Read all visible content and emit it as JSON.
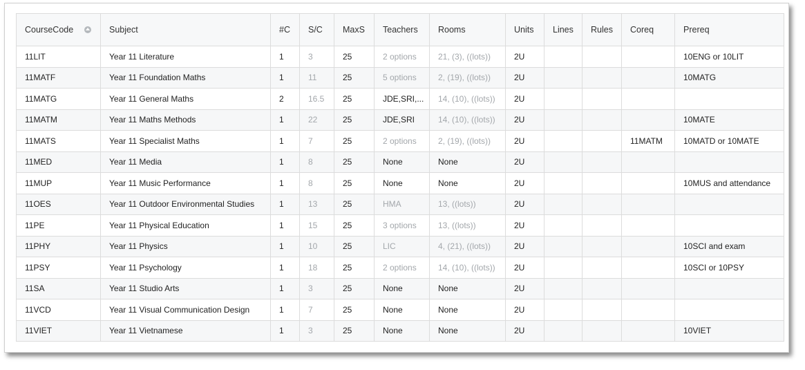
{
  "columns": [
    {
      "key": "code",
      "label": "CourseCode"
    },
    {
      "key": "subject",
      "label": "Subject"
    },
    {
      "key": "c",
      "label": "#C"
    },
    {
      "key": "sc",
      "label": "S/C"
    },
    {
      "key": "maxs",
      "label": "MaxS"
    },
    {
      "key": "teachers",
      "label": "Teachers"
    },
    {
      "key": "rooms",
      "label": "Rooms"
    },
    {
      "key": "units",
      "label": "Units"
    },
    {
      "key": "lines",
      "label": "Lines"
    },
    {
      "key": "rules",
      "label": "Rules"
    },
    {
      "key": "coreq",
      "label": "Coreq"
    },
    {
      "key": "prereq",
      "label": "Prereq"
    }
  ],
  "sort_icon": "sort-ascending-icon",
  "colors": {
    "muted_text": "#a3a7ab",
    "stripe": "#f6f7f8",
    "header_bg": "#f7f8f9",
    "border": "#dcdcdc"
  },
  "rows": [
    {
      "code": "11LIT",
      "subject": "Year 11 Literature",
      "c": "1",
      "sc": "3",
      "maxs": "25",
      "teachers": "2 options",
      "teachers_muted": true,
      "rooms": "21, (3), ((lots))",
      "rooms_muted": true,
      "units": "2U",
      "lines": "",
      "rules": "",
      "coreq": "",
      "prereq": "10ENG or 10LIT"
    },
    {
      "code": "11MATF",
      "subject": "Year 11 Foundation Maths",
      "c": "1",
      "sc": "11",
      "maxs": "25",
      "teachers": "5 options",
      "teachers_muted": true,
      "rooms": "2, (19), ((lots))",
      "rooms_muted": true,
      "units": "2U",
      "lines": "",
      "rules": "",
      "coreq": "",
      "prereq": "10MATG"
    },
    {
      "code": "11MATG",
      "subject": "Year 11 General Maths",
      "c": "2",
      "sc": "16.5",
      "maxs": "25",
      "teachers": "JDE,SRI,...",
      "teachers_muted": false,
      "rooms": "14, (10), ((lots))",
      "rooms_muted": true,
      "units": "2U",
      "lines": "",
      "rules": "",
      "coreq": "",
      "prereq": ""
    },
    {
      "code": "11MATM",
      "subject": "Year 11 Maths Methods",
      "c": "1",
      "sc": "22",
      "maxs": "25",
      "teachers": "JDE,SRI",
      "teachers_muted": false,
      "rooms": "14, (10), ((lots))",
      "rooms_muted": true,
      "units": "2U",
      "lines": "",
      "rules": "",
      "coreq": "",
      "prereq": "10MATE"
    },
    {
      "code": "11MATS",
      "subject": "Year 11 Specialist Maths",
      "c": "1",
      "sc": "7",
      "maxs": "25",
      "teachers": "2 options",
      "teachers_muted": true,
      "rooms": "2, (19), ((lots))",
      "rooms_muted": true,
      "units": "2U",
      "lines": "",
      "rules": "",
      "coreq": "11MATM",
      "prereq": "10MATD or 10MATE"
    },
    {
      "code": "11MED",
      "subject": "Year 11 Media",
      "c": "1",
      "sc": "8",
      "maxs": "25",
      "teachers": "None",
      "teachers_muted": false,
      "rooms": "None",
      "rooms_muted": false,
      "units": "2U",
      "lines": "",
      "rules": "",
      "coreq": "",
      "prereq": ""
    },
    {
      "code": "11MUP",
      "subject": "Year 11 Music Performance",
      "c": "1",
      "sc": "8",
      "maxs": "25",
      "teachers": "None",
      "teachers_muted": false,
      "rooms": "None",
      "rooms_muted": false,
      "units": "2U",
      "lines": "",
      "rules": "",
      "coreq": "",
      "prereq": "10MUS and attendance"
    },
    {
      "code": "11OES",
      "subject": "Year 11 Outdoor Environmental Studies",
      "c": "1",
      "sc": "13",
      "maxs": "25",
      "teachers": "HMA",
      "teachers_muted": true,
      "rooms": "13, ((lots))",
      "rooms_muted": true,
      "units": "2U",
      "lines": "",
      "rules": "",
      "coreq": "",
      "prereq": ""
    },
    {
      "code": "11PE",
      "subject": "Year 11 Physical Education",
      "c": "1",
      "sc": "15",
      "maxs": "25",
      "teachers": "3 options",
      "teachers_muted": true,
      "rooms": "13, ((lots))",
      "rooms_muted": true,
      "units": "2U",
      "lines": "",
      "rules": "",
      "coreq": "",
      "prereq": ""
    },
    {
      "code": "11PHY",
      "subject": "Year 11 Physics",
      "c": "1",
      "sc": "10",
      "maxs": "25",
      "teachers": "LIC",
      "teachers_muted": true,
      "rooms": "4, (21), ((lots))",
      "rooms_muted": true,
      "units": "2U",
      "lines": "",
      "rules": "",
      "coreq": "",
      "prereq": "10SCI and exam"
    },
    {
      "code": "11PSY",
      "subject": "Year 11 Psychology",
      "c": "1",
      "sc": "18",
      "maxs": "25",
      "teachers": "2 options",
      "teachers_muted": true,
      "rooms": "14, (10), ((lots))",
      "rooms_muted": true,
      "units": "2U",
      "lines": "",
      "rules": "",
      "coreq": "",
      "prereq": "10SCI or 10PSY"
    },
    {
      "code": "11SA",
      "subject": "Year 11 Studio Arts",
      "c": "1",
      "sc": "3",
      "maxs": "25",
      "teachers": "None",
      "teachers_muted": false,
      "rooms": "None",
      "rooms_muted": false,
      "units": "2U",
      "lines": "",
      "rules": "",
      "coreq": "",
      "prereq": ""
    },
    {
      "code": "11VCD",
      "subject": "Year 11 Visual Communication Design",
      "c": "1",
      "sc": "7",
      "maxs": "25",
      "teachers": "None",
      "teachers_muted": false,
      "rooms": "None",
      "rooms_muted": false,
      "units": "2U",
      "lines": "",
      "rules": "",
      "coreq": "",
      "prereq": ""
    },
    {
      "code": "11VIET",
      "subject": "Year 11 Vietnamese",
      "c": "1",
      "sc": "3",
      "maxs": "25",
      "teachers": "None",
      "teachers_muted": false,
      "rooms": "None",
      "rooms_muted": false,
      "units": "2U",
      "lines": "",
      "rules": "",
      "coreq": "",
      "prereq": "10VIET"
    }
  ]
}
